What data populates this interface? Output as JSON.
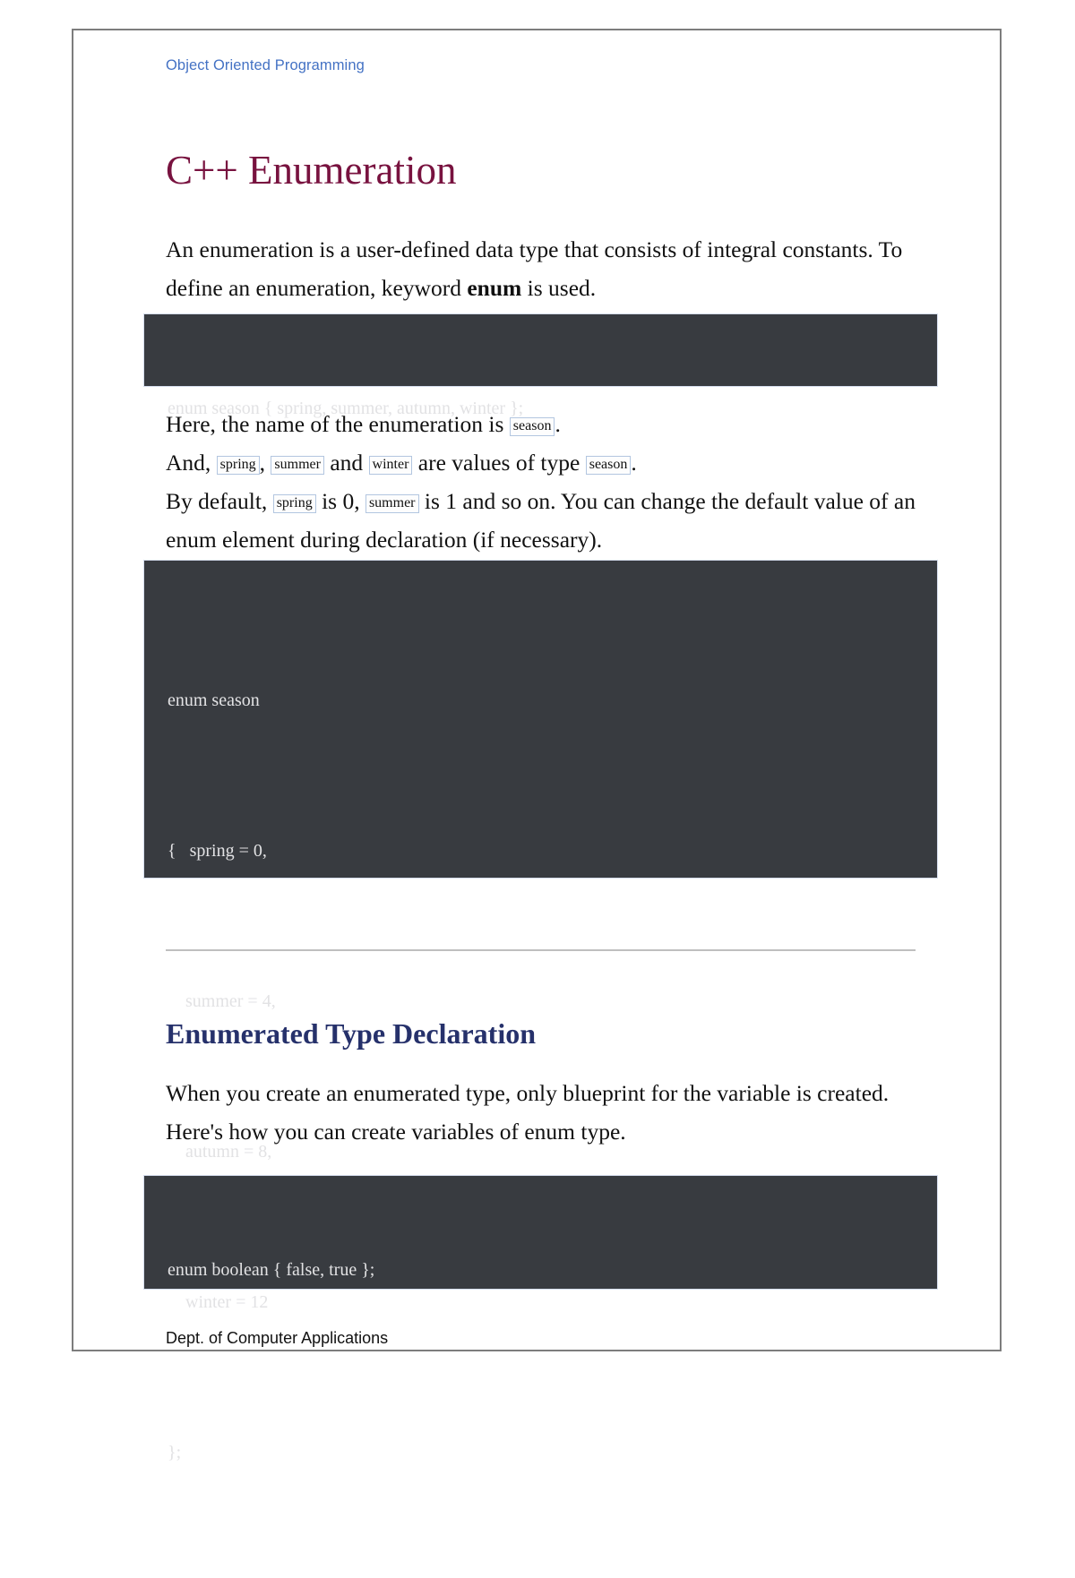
{
  "document": {
    "header_label": "Object Oriented Programming",
    "title": "C++ Enumeration",
    "footer_label": "Dept. of Computer Applications"
  },
  "intro": {
    "line1_a": "An enumeration is a user-defined data type that consists of integral constants. To",
    "line2_a": "define an enumeration, keyword ",
    "line2_keyword": "enum",
    "line2_b": " is used."
  },
  "code_block_1": {
    "line1": "enum season { spring, summer, autumn, winter };"
  },
  "explain": {
    "l1_a": "Here, the name of the enumeration is ",
    "l1_chip": "season",
    "l1_b": ".",
    "l2_a": "And, ",
    "l2_chip1": "spring",
    "l2_b": ", ",
    "l2_chip2": "summer",
    "l2_c": " and ",
    "l2_chip3": "winter",
    "l2_d": " are values of type ",
    "l2_chip4": "season",
    "l2_e": ".",
    "l3_a": "By default, ",
    "l3_chip1": "spring",
    "l3_b": " is 0, ",
    "l3_chip2": "summer",
    "l3_c": " is 1 and so on. You can change the default value of an",
    "l4_a": "enum element during declaration (if necessary)."
  },
  "code_block_2": {
    "line1": "enum season",
    "line2": "{   spring = 0,",
    "line3": "    summer = 4,",
    "line4": "    autumn = 8,",
    "line5": "    winter = 12",
    "line6": "};"
  },
  "section2": {
    "heading": "Enumerated Type Declaration",
    "para_line1": "When you create an enumerated type, only blueprint for the variable is created.",
    "para_line2": "Here's how you can create variables of enum type."
  },
  "code_block_3": {
    "line1": "enum boolean { false, true };"
  },
  "colors": {
    "header_blue": "#4472c4",
    "title_maroon": "#78123f",
    "heading_navy": "#26316b",
    "code_bg": "#383b40",
    "code_fg": "#e2e2e4",
    "chip_border": "#b3c6e0",
    "page_border": "#7d7d7d",
    "rule": "#bfbfbf"
  }
}
